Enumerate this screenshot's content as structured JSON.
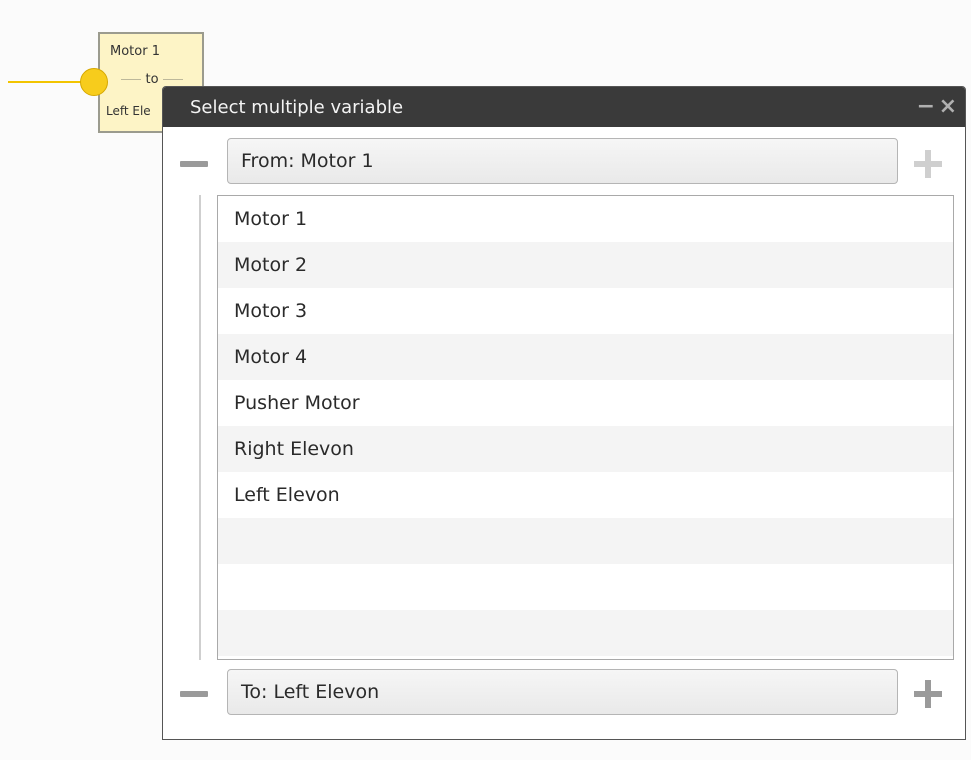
{
  "node": {
    "from_label": "Motor 1",
    "connector": "to",
    "to_label": "Left Ele"
  },
  "dialog": {
    "title": "Select multiple variable",
    "minimize_glyph": "−",
    "close_glyph": "×",
    "from_field": "From: Motor 1",
    "to_field": "To: Left Elevon",
    "items": [
      "Motor 1",
      "Motor 2",
      "Motor 3",
      "Motor 4",
      "Pusher Motor",
      "Right Elevon",
      "Left Elevon",
      "",
      "",
      ""
    ]
  },
  "icons": [
    "minus-icon",
    "plus-icon",
    "minimize-icon",
    "close-icon"
  ],
  "colors": {
    "wire": "#f2c400",
    "node_fill": "#fdf4c6",
    "titlebar": "#3a3a3a"
  }
}
